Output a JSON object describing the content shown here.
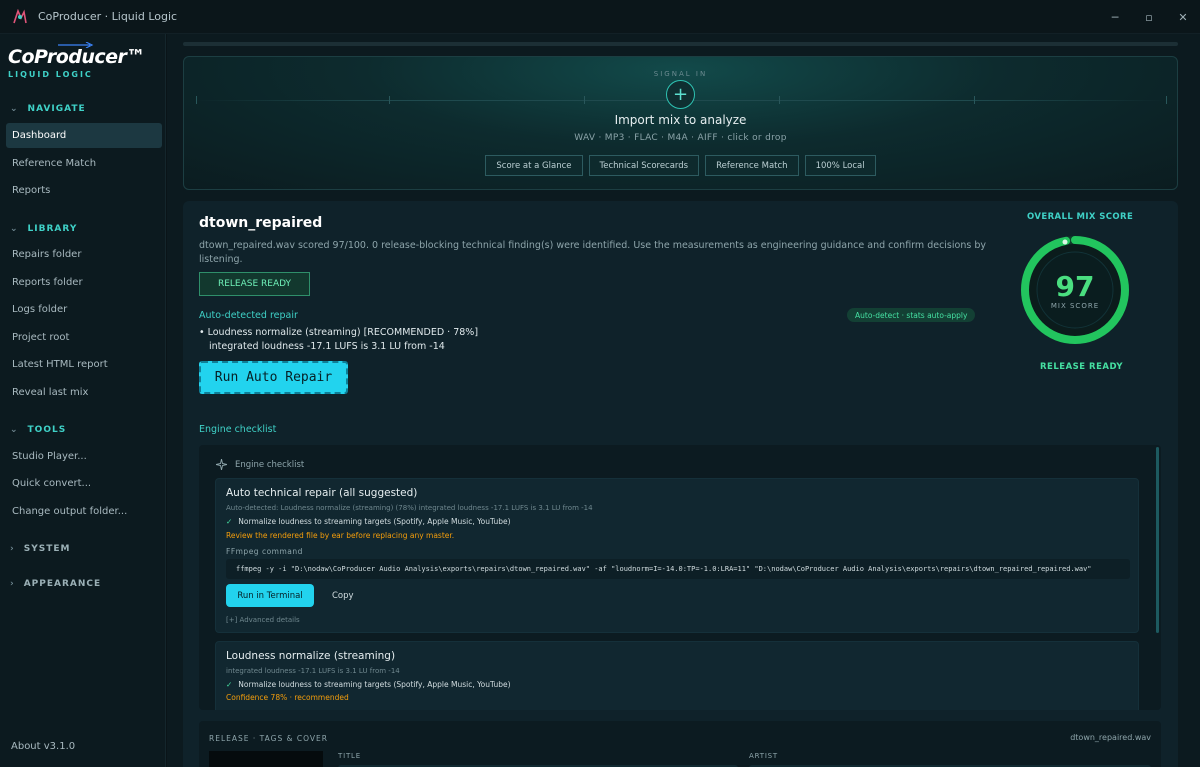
{
  "window": {
    "title": "CoProducer · Liquid Logic",
    "controls": [
      "─",
      "▫",
      "✕"
    ]
  },
  "sidebar": {
    "logo": "CoProducer™",
    "logo_sub": "LIQUID LOGIC",
    "sections": {
      "navigate": "NAVIGATE",
      "library": "LIBRARY",
      "tools": "TOOLS",
      "system": "SYSTEM",
      "appearance": "APPEARANCE"
    },
    "navigate_items": [
      "Dashboard",
      "Reference Match",
      "Reports"
    ],
    "library_items": [
      "Repairs folder",
      "Reports folder",
      "Logs folder",
      "Project root",
      "Latest HTML report",
      "Reveal last mix"
    ],
    "tools_items": [
      "Studio Player...",
      "Quick convert...",
      "Change output folder..."
    ],
    "about": "About v3.1.0"
  },
  "signal": {
    "label": "SIGNAL IN",
    "title": "Import mix to analyze",
    "formats": "WAV · MP3 · FLAC · M4A · AIFF  ·  click or drop",
    "chips": [
      "Score at a Glance",
      "Technical Scorecards",
      "Reference Match",
      "100% Local"
    ]
  },
  "mix": {
    "name": "dtown_repaired",
    "description": "dtown_repaired.wav scored 97/100. 0 release-blocking technical finding(s) were identified. Use the measurements as engineering guidance and confirm decisions by listening.",
    "status_button": "RELEASE READY",
    "auto_label": "Auto-detected repair",
    "auto_badge": "Auto-detect · stats auto-apply",
    "repair_line1": "• Loudness normalize (streaming)  [RECOMMENDED · 78%]",
    "repair_line2": "integrated loudness -17.1 LUFS is 3.1 LU from -14",
    "run_auto": "Run Auto Repair"
  },
  "score": {
    "title": "OVERALL MIX SCORE",
    "value": "97",
    "label": "MIX SCORE",
    "fraction": 0.97,
    "status": "RELEASE READY",
    "accent": "#22c55e"
  },
  "engine": {
    "section_label": "Engine checklist",
    "box_title": "Engine checklist",
    "card1": {
      "title": "Auto technical repair (all suggested)",
      "detail": "Auto-detected: Loudness normalize (streaming) (78%) integrated loudness -17.1 LUFS is 3.1 LU from -14",
      "check": "Normalize loudness to streaming targets (Spotify, Apple Music, YouTube)",
      "warning": "Review the rendered file by ear before replacing any master.",
      "ff_label": "FFmpeg command",
      "command": "ffmpeg -y -i \"D:\\nodaw\\CoProducer Audio Analysis\\exports\\repairs\\dtown_repaired.wav\" -af \"loudnorm=I=-14.0:TP=-1.0:LRA=11\" \"D:\\nodaw\\CoProducer Audio Analysis\\exports\\repairs\\dtown_repaired_repaired.wav\"",
      "run_button": "Run in Terminal",
      "copy_button": "Copy",
      "advanced": "[+] Advanced details"
    },
    "card2": {
      "title": "Loudness normalize (streaming)",
      "detail": "integrated loudness -17.1 LUFS is 3.1 LU from -14",
      "check": "Normalize loudness to streaming targets (Spotify, Apple Music, YouTube)",
      "confidence": "Confidence 78% · recommended"
    }
  },
  "release": {
    "title": "RELEASE · TAGS & COVER",
    "file": "dtown_repaired.wav",
    "col_title": "TITLE",
    "col_artist": "ARTIST"
  }
}
